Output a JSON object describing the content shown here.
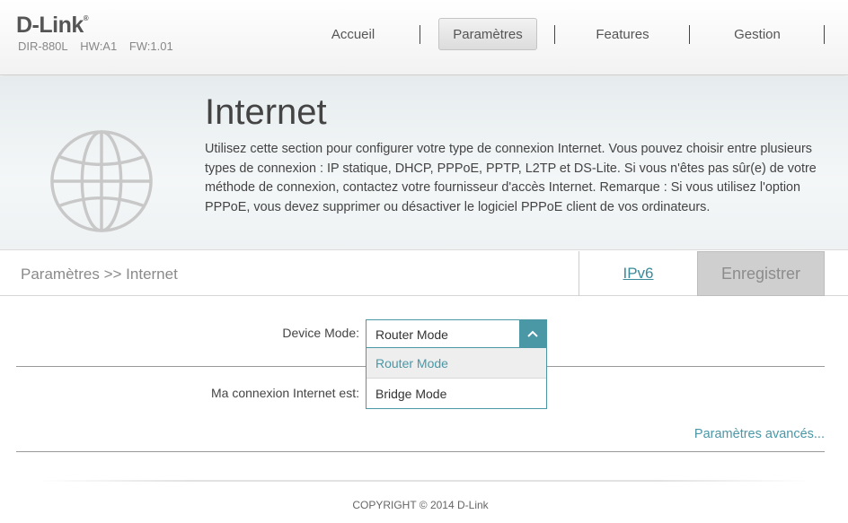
{
  "brand": {
    "logo": "D-Link",
    "trademark": "®",
    "model": "DIR-880L",
    "hw": "HW:A1",
    "fw": "FW:1.01"
  },
  "nav": [
    {
      "label": "Accueil",
      "active": false
    },
    {
      "label": "Paramètres",
      "active": true
    },
    {
      "label": "Features",
      "active": false
    },
    {
      "label": "Gestion",
      "active": false
    }
  ],
  "banner": {
    "title": "Internet",
    "description": "Utilisez cette section pour configurer votre type de connexion Internet. Vous pouvez choisir entre plusieurs types de connexion : IP statique, DHCP, PPPoE, PPTP, L2TP et DS-Lite. Si vous n'êtes pas sûr(e) de votre méthode de connexion, contactez votre fournisseur d'accès Internet. Remarque : Si vous utilisez l'option PPPoE, vous devez supprimer ou désactiver le logiciel PPPoE client de vos ordinateurs.",
    "icon": "globe-icon"
  },
  "subbar": {
    "breadcrumb": "Paramètres >> Internet",
    "ipv6_label": "IPv6",
    "save_label": "Enregistrer"
  },
  "form": {
    "device_mode_label": "Device Mode:",
    "device_mode_value": "Router Mode",
    "device_mode_options": [
      "Router Mode",
      "Bridge Mode"
    ],
    "connection_label": "Ma connexion Internet est:",
    "advanced_link": "Paramètres avancés..."
  },
  "footer": {
    "copyright": "COPYRIGHT © 2014 D-Link"
  },
  "colors": {
    "accent": "#4a97a6",
    "save_bg": "#cfcfcf"
  }
}
